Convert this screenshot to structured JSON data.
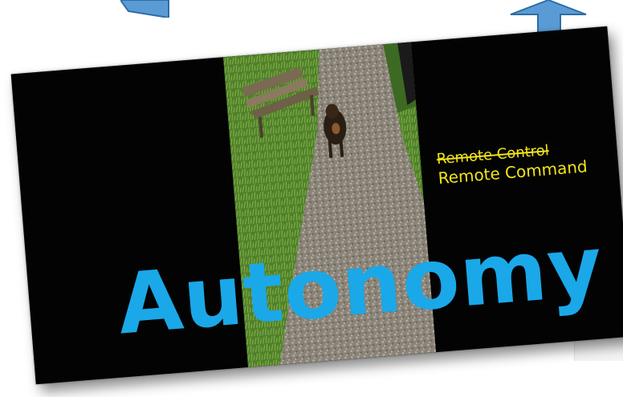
{
  "slide": {
    "strike_text": "Remote Control",
    "command_text": "Remote Command",
    "headline": "Autonomy"
  },
  "colors": {
    "slide_background": "#030303",
    "label_yellow": "#f0e41a",
    "headline_blue": "#1aa8e8",
    "arrow_blue": "#6fa8dc"
  },
  "icons": {
    "left_arrow": "left-arrow-icon",
    "up_arrow": "up-arrow-icon"
  }
}
